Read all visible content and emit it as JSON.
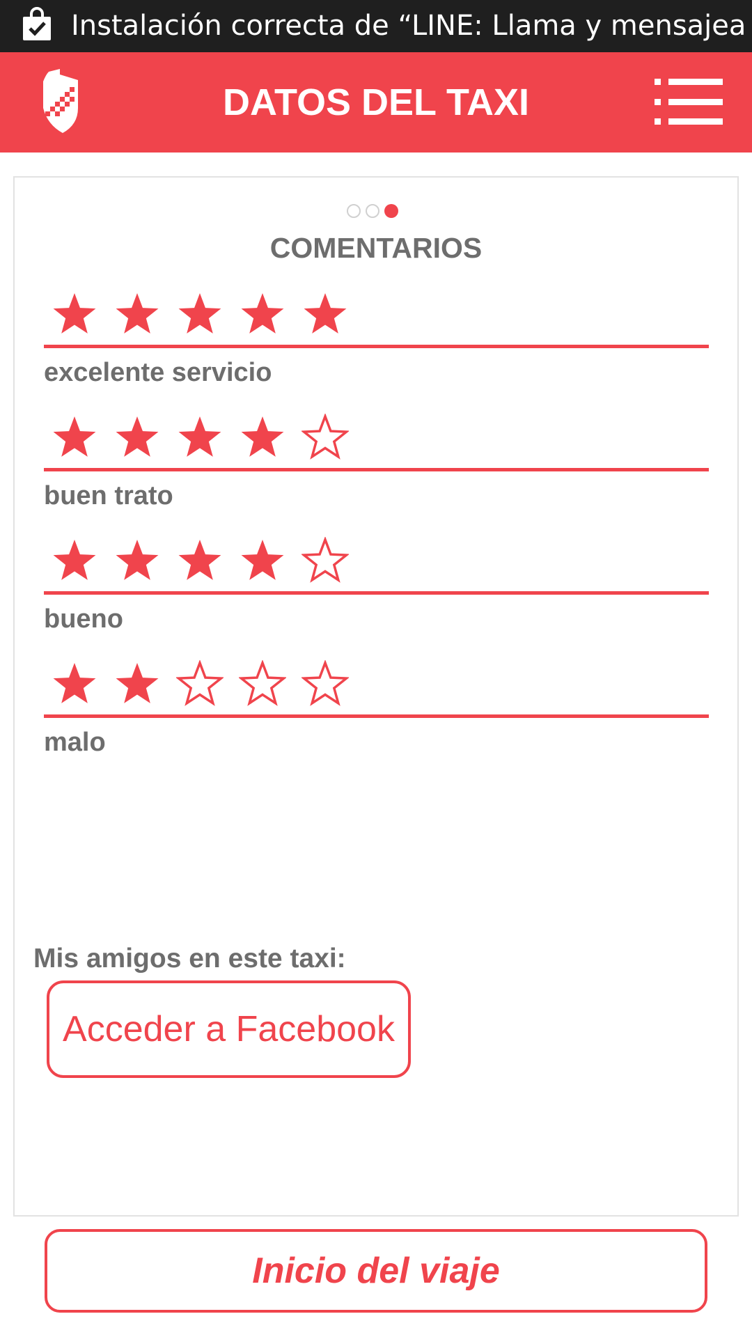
{
  "status_bar": {
    "notification_text": "Instalación correcta de “LINE: Llama y mensajea"
  },
  "app_bar": {
    "title": "DATOS DEL TAXI"
  },
  "pager": {
    "total_pages": 3,
    "current_page": 3
  },
  "comments": {
    "title": "COMENTARIOS",
    "items": [
      {
        "rating": 5,
        "max": 5,
        "text": "excelente servicio"
      },
      {
        "rating": 4,
        "max": 5,
        "text": "buen trato"
      },
      {
        "rating": 4,
        "max": 5,
        "text": "bueno"
      },
      {
        "rating": 2,
        "max": 5,
        "text": "malo"
      }
    ]
  },
  "friends": {
    "label": "Mis amigos en este taxi:",
    "facebook_button": "Acceder a Facebook"
  },
  "footer": {
    "start_button": "Inicio del viaje"
  },
  "colors": {
    "accent": "#f0444c",
    "status_bar": "#1f1f1f",
    "text_gray": "#6d6d6d"
  }
}
